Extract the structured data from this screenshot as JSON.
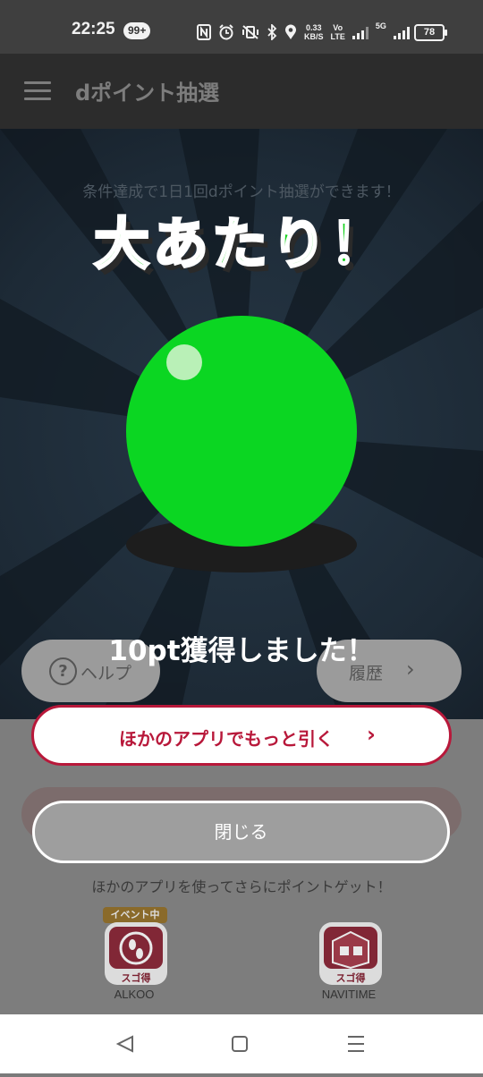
{
  "status_bar": {
    "time": "22:25",
    "notification_count": "99+",
    "net_speed_value": "0.33",
    "net_speed_unit": "KB/S",
    "volte_top": "Vo",
    "volte_bottom": "LTE",
    "signal2_label": "5G",
    "battery": "78"
  },
  "app_bar": {
    "title": "dポイント抽選"
  },
  "page": {
    "subtitle": "条件達成で1日1回dポイント抽選ができます！",
    "help_label": "ヘルプ",
    "help_icon_glyph": "?",
    "history_label": "履歴",
    "history_chevron": "›",
    "promo_text": "ほかのアプリを使ってさらにポイントゲット！",
    "apps": [
      {
        "name": "ALKOO",
        "badge": "イベント中",
        "tag": "スゴ得"
      },
      {
        "name": "NAVITIME",
        "tag": "スゴ得"
      }
    ]
  },
  "popup": {
    "headline": "大あたり！",
    "ball_color": "#0bd622",
    "headline_color": "#14d21c",
    "result_text": "10pt獲得しました！",
    "cta_label": "ほかのアプリでもっと引く",
    "cta_chevron": "›",
    "cta_color": "#b8183a",
    "close_label": "閉じる"
  }
}
